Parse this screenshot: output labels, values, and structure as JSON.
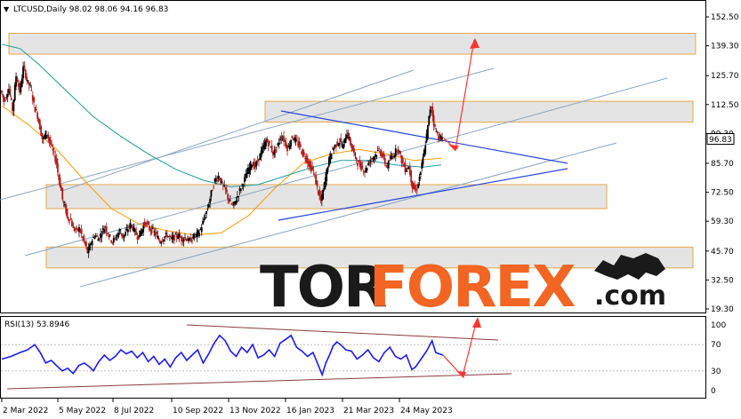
{
  "chart_data": {
    "type": "candlestick",
    "symbol": "LTCUSD",
    "timeframe": "Daily",
    "ohlc_readout": {
      "open": "98.02",
      "high": "98.06",
      "low": "94.16",
      "close": "96.83"
    },
    "current_price": "96.83",
    "x_ticks": [
      "2 Mar 2022",
      "5 May 2022",
      "8 Jul 2022",
      "10 Sep 2022",
      "13 Nov 2022",
      "16 Jan 2023",
      "21 Mar 2023",
      "24 May 2023"
    ],
    "y_ticks": [
      "152.50",
      "139.30",
      "125.70",
      "112.50",
      "99.30",
      "85.70",
      "72.50",
      "59.30",
      "45.70",
      "32.50",
      "19.30"
    ],
    "ylim": [
      19.3,
      152.5
    ],
    "price_path": [
      [
        0,
        119
      ],
      [
        4,
        114
      ],
      [
        9,
        120
      ],
      [
        13,
        110
      ],
      [
        17,
        126
      ],
      [
        21,
        118
      ],
      [
        25,
        130
      ],
      [
        29,
        123
      ],
      [
        33,
        120
      ],
      [
        37,
        111
      ],
      [
        40,
        108
      ],
      [
        42,
        104
      ],
      [
        46,
        96
      ],
      [
        50,
        100
      ],
      [
        54,
        95
      ],
      [
        58,
        90
      ],
      [
        61,
        86
      ],
      [
        63,
        80
      ],
      [
        66,
        74
      ],
      [
        68,
        68
      ],
      [
        71,
        65
      ],
      [
        73,
        60
      ],
      [
        76,
        61
      ],
      [
        79,
        56
      ],
      [
        83,
        55
      ],
      [
        86,
        56
      ],
      [
        90,
        51
      ],
      [
        93,
        48
      ],
      [
        95,
        45
      ],
      [
        97,
        47
      ],
      [
        99,
        50
      ],
      [
        103,
        53
      ],
      [
        107,
        51
      ],
      [
        110,
        54
      ],
      [
        114,
        57
      ],
      [
        118,
        53
      ],
      [
        122,
        50
      ],
      [
        126,
        52
      ],
      [
        130,
        55
      ],
      [
        134,
        52
      ],
      [
        138,
        55
      ],
      [
        142,
        58
      ],
      [
        146,
        55
      ],
      [
        150,
        52
      ],
      [
        154,
        55
      ],
      [
        158,
        59
      ],
      [
        162,
        56
      ],
      [
        166,
        55
      ],
      [
        170,
        53
      ],
      [
        174,
        50
      ],
      [
        178,
        52
      ],
      [
        182,
        53
      ],
      [
        186,
        51
      ],
      [
        190,
        52
      ],
      [
        194,
        53
      ],
      [
        198,
        51
      ],
      [
        202,
        52
      ],
      [
        206,
        50
      ],
      [
        210,
        52
      ],
      [
        214,
        53
      ],
      [
        218,
        55
      ],
      [
        222,
        60
      ],
      [
        226,
        65
      ],
      [
        230,
        72
      ],
      [
        234,
        78
      ],
      [
        238,
        80
      ],
      [
        242,
        76
      ],
      [
        246,
        73
      ],
      [
        250,
        68
      ],
      [
        254,
        66
      ],
      [
        258,
        70
      ],
      [
        262,
        74
      ],
      [
        266,
        78
      ],
      [
        270,
        82
      ],
      [
        274,
        86
      ],
      [
        278,
        84
      ],
      [
        282,
        88
      ],
      [
        286,
        92
      ],
      [
        290,
        96
      ],
      [
        294,
        94
      ],
      [
        298,
        90
      ],
      [
        302,
        93
      ],
      [
        306,
        98
      ],
      [
        310,
        96
      ],
      [
        314,
        92
      ],
      [
        318,
        98
      ],
      [
        322,
        96
      ],
      [
        326,
        94
      ],
      [
        330,
        90
      ],
      [
        334,
        88
      ],
      [
        338,
        84
      ],
      [
        342,
        82
      ],
      [
        346,
        74
      ],
      [
        350,
        68
      ],
      [
        354,
        77
      ],
      [
        358,
        86
      ],
      [
        362,
        92
      ],
      [
        366,
        94
      ],
      [
        370,
        96
      ],
      [
        374,
        93
      ],
      [
        378,
        100
      ],
      [
        382,
        95
      ],
      [
        386,
        90
      ],
      [
        390,
        86
      ],
      [
        394,
        84
      ],
      [
        398,
        82
      ],
      [
        402,
        86
      ],
      [
        406,
        88
      ],
      [
        410,
        90
      ],
      [
        414,
        92
      ],
      [
        418,
        88
      ],
      [
        422,
        84
      ],
      [
        426,
        88
      ],
      [
        430,
        90
      ],
      [
        434,
        93
      ],
      [
        438,
        87
      ],
      [
        442,
        83
      ],
      [
        446,
        84
      ],
      [
        450,
        75
      ],
      [
        454,
        73
      ],
      [
        458,
        80
      ],
      [
        462,
        89
      ],
      [
        466,
        100
      ],
      [
        470,
        113
      ],
      [
        474,
        102
      ],
      [
        478,
        98
      ],
      [
        482,
        96.83
      ]
    ],
    "moving_averages": [
      {
        "name": "MA-1",
        "color": "#ff9900",
        "values": [
          [
            0,
            112
          ],
          [
            30,
            103
          ],
          [
            60,
            92
          ],
          [
            90,
            78
          ],
          [
            120,
            65
          ],
          [
            150,
            58
          ],
          [
            180,
            55
          ],
          [
            210,
            53
          ],
          [
            240,
            54
          ],
          [
            270,
            62
          ],
          [
            300,
            75
          ],
          [
            330,
            86
          ],
          [
            360,
            90
          ],
          [
            390,
            92
          ],
          [
            420,
            90
          ],
          [
            450,
            87
          ],
          [
            480,
            88
          ]
        ]
      },
      {
        "name": "MA-2",
        "color": "#1a9c9c",
        "values": [
          [
            0,
            140
          ],
          [
            20,
            138
          ],
          [
            40,
            131
          ],
          [
            60,
            123
          ],
          [
            80,
            115
          ],
          [
            100,
            107
          ],
          [
            130,
            98
          ],
          [
            160,
            90
          ],
          [
            190,
            83
          ],
          [
            220,
            78
          ],
          [
            250,
            75
          ],
          [
            280,
            76
          ],
          [
            310,
            80
          ],
          [
            340,
            84
          ],
          [
            370,
            87
          ],
          [
            400,
            87
          ],
          [
            430,
            85
          ],
          [
            460,
            84
          ],
          [
            480,
            85
          ]
        ]
      }
    ],
    "horizontal_zones": [
      {
        "from": 135.5,
        "to": 145.0
      },
      {
        "from": 104.5,
        "to": 114.0
      },
      {
        "from": 65.0,
        "to": 76.0
      },
      {
        "from": 38.0,
        "to": 47.5
      }
    ],
    "forecast": {
      "targets": [
        92,
        142
      ]
    },
    "rsi": {
      "label": "RSI(13) 53.8946",
      "levels": [
        "70",
        "30"
      ],
      "scale_ticks": [
        "100",
        "70",
        "30",
        "0"
      ],
      "path": [
        [
          0,
          48
        ],
        [
          10,
          52
        ],
        [
          20,
          58
        ],
        [
          28,
          62
        ],
        [
          36,
          70
        ],
        [
          42,
          58
        ],
        [
          48,
          42
        ],
        [
          54,
          46
        ],
        [
          60,
          38
        ],
        [
          66,
          30
        ],
        [
          72,
          34
        ],
        [
          78,
          26
        ],
        [
          84,
          38
        ],
        [
          90,
          42
        ],
        [
          96,
          36
        ],
        [
          100,
          30
        ],
        [
          106,
          44
        ],
        [
          112,
          54
        ],
        [
          118,
          46
        ],
        [
          124,
          52
        ],
        [
          130,
          62
        ],
        [
          136,
          56
        ],
        [
          142,
          60
        ],
        [
          148,
          50
        ],
        [
          154,
          58
        ],
        [
          160,
          44
        ],
        [
          166,
          52
        ],
        [
          172,
          40
        ],
        [
          178,
          48
        ],
        [
          184,
          36
        ],
        [
          190,
          50
        ],
        [
          196,
          58
        ],
        [
          202,
          46
        ],
        [
          208,
          54
        ],
        [
          214,
          62
        ],
        [
          220,
          42
        ],
        [
          226,
          56
        ],
        [
          232,
          72
        ],
        [
          238,
          84
        ],
        [
          244,
          76
        ],
        [
          250,
          60
        ],
        [
          256,
          52
        ],
        [
          262,
          66
        ],
        [
          268,
          58
        ],
        [
          274,
          70
        ],
        [
          280,
          50
        ],
        [
          286,
          54
        ],
        [
          292,
          62
        ],
        [
          298,
          52
        ],
        [
          304,
          72
        ],
        [
          310,
          78
        ],
        [
          316,
          84
        ],
        [
          322,
          66
        ],
        [
          328,
          60
        ],
        [
          334,
          52
        ],
        [
          340,
          58
        ],
        [
          346,
          38
        ],
        [
          350,
          24
        ],
        [
          354,
          42
        ],
        [
          358,
          54
        ],
        [
          362,
          68
        ],
        [
          366,
          74
        ],
        [
          370,
          70
        ],
        [
          376,
          62
        ],
        [
          382,
          60
        ],
        [
          388,
          48
        ],
        [
          394,
          54
        ],
        [
          400,
          62
        ],
        [
          406,
          50
        ],
        [
          412,
          44
        ],
        [
          418,
          58
        ],
        [
          424,
          66
        ],
        [
          430,
          52
        ],
        [
          436,
          48
        ],
        [
          442,
          54
        ],
        [
          448,
          32
        ],
        [
          452,
          36
        ],
        [
          458,
          48
        ],
        [
          464,
          60
        ],
        [
          470,
          76
        ],
        [
          474,
          58
        ],
        [
          478,
          56
        ],
        [
          482,
          53.9
        ]
      ]
    }
  },
  "watermark": {
    "text_left": "TOR",
    "text_right": "FOREX",
    "suffix": ".com"
  }
}
